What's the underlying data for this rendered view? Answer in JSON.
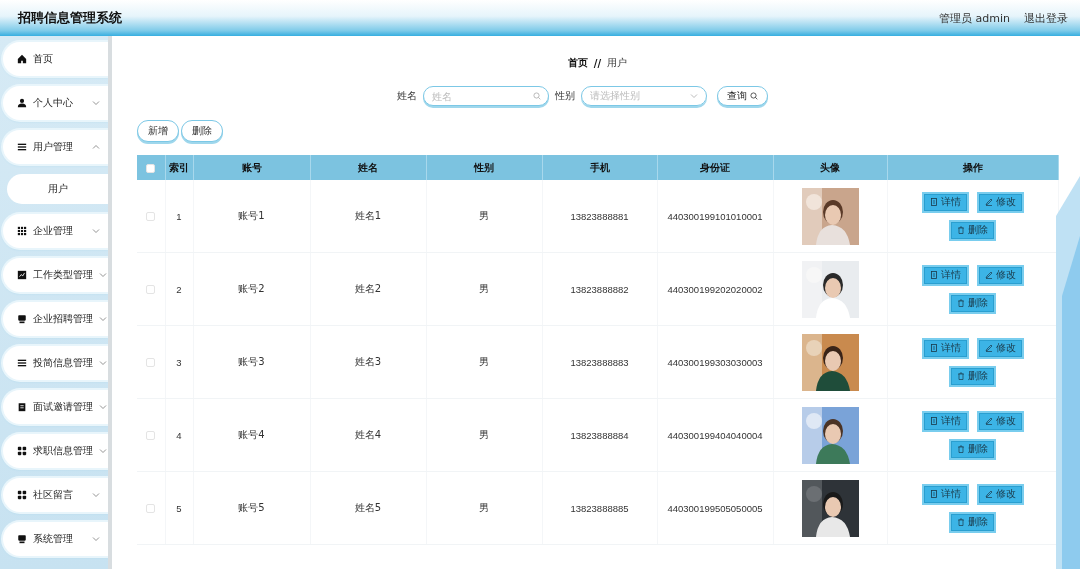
{
  "header": {
    "title": "招聘信息管理系统",
    "user": "管理员 admin",
    "logout": "退出登录"
  },
  "sidebar": {
    "items": [
      {
        "label": "首页",
        "kind": "link"
      },
      {
        "label": "个人中心",
        "kind": "menu",
        "expanded": false
      },
      {
        "label": "用户管理",
        "kind": "menu",
        "expanded": true,
        "children": [
          {
            "label": "用户"
          }
        ]
      },
      {
        "label": "企业管理",
        "kind": "menu",
        "expanded": false
      },
      {
        "label": "工作类型管理",
        "kind": "menu",
        "expanded": false
      },
      {
        "label": "企业招聘管理",
        "kind": "menu",
        "expanded": false
      },
      {
        "label": "投简信息管理",
        "kind": "menu",
        "expanded": false
      },
      {
        "label": "面试邀请管理",
        "kind": "menu",
        "expanded": false
      },
      {
        "label": "求职信息管理",
        "kind": "menu",
        "expanded": false
      },
      {
        "label": "社区留言",
        "kind": "menu",
        "expanded": false
      },
      {
        "label": "系统管理",
        "kind": "menu",
        "expanded": false
      }
    ]
  },
  "breadcrumb": {
    "home": "首页",
    "separator": "//",
    "current": "用户"
  },
  "search": {
    "name_label": "姓名",
    "name_placeholder": "姓名",
    "gender_label": "性别",
    "gender_placeholder": "请选择性别",
    "query_button": "查询"
  },
  "actions": [
    "新增",
    "删除"
  ],
  "table": {
    "columns": [
      "索引",
      "账号",
      "姓名",
      "性别",
      "手机",
      "身份证",
      "头像",
      "操作"
    ],
    "header_checked": false,
    "rows": [
      {
        "checked": false,
        "index": "1",
        "account": "账号1",
        "name": "姓名1",
        "gender": "男",
        "phone": "13823888881",
        "id_card": "440300199101010001",
        "buttons": [
          {
            "kind": "detail",
            "label": "详情"
          },
          {
            "kind": "edit",
            "label": "修改"
          },
          {
            "kind": "delete",
            "label": "删除"
          }
        ]
      },
      {
        "checked": false,
        "index": "2",
        "account": "账号2",
        "name": "姓名2",
        "gender": "男",
        "phone": "13823888882",
        "id_card": "440300199202020002",
        "buttons": [
          {
            "kind": "detail",
            "label": "详情"
          },
          {
            "kind": "edit",
            "label": "修改"
          },
          {
            "kind": "delete",
            "label": "删除"
          }
        ]
      },
      {
        "checked": false,
        "index": "3",
        "account": "账号3",
        "name": "姓名3",
        "gender": "男",
        "phone": "13823888883",
        "id_card": "440300199303030003",
        "buttons": [
          {
            "kind": "detail",
            "label": "详情"
          },
          {
            "kind": "edit",
            "label": "修改"
          },
          {
            "kind": "delete",
            "label": "删除"
          }
        ]
      },
      {
        "checked": false,
        "index": "4",
        "account": "账号4",
        "name": "姓名4",
        "gender": "男",
        "phone": "13823888884",
        "id_card": "440300199404040004",
        "buttons": [
          {
            "kind": "detail",
            "label": "详情"
          },
          {
            "kind": "edit",
            "label": "修改"
          },
          {
            "kind": "delete",
            "label": "删除"
          }
        ]
      },
      {
        "checked": false,
        "index": "5",
        "account": "账号5",
        "name": "姓名5",
        "gender": "男",
        "phone": "13823888885",
        "id_card": "440300199505050005",
        "buttons": [
          {
            "kind": "detail",
            "label": "详情"
          },
          {
            "kind": "edit",
            "label": "修改"
          },
          {
            "kind": "delete",
            "label": "删除"
          }
        ]
      }
    ]
  }
}
